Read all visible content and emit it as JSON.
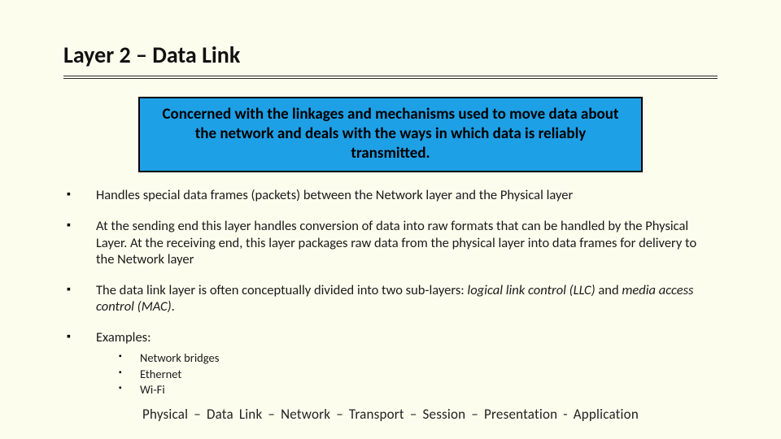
{
  "title": "Layer 2 – Data Link",
  "blurb": "Concerned with the linkages and mechanisms used to move data about the network and deals with the ways in which data is reliably transmitted.",
  "bullets": {
    "b0": "Handles special data frames (packets) between the Network layer and the Physical layer",
    "b1": "At the sending end this layer handles conversion of data into raw formats that can be handled by the Physical Layer. At the receiving end, this layer packages raw data from the physical layer into data frames for delivery to the Network layer",
    "b2_pre": "The data link layer is often conceptually divided into two sub-layers: ",
    "b2_llc": "logical link control (LLC)",
    "b2_mid": " and ",
    "b2_mac": "media access control (MAC)",
    "b2_post": ".",
    "b3": "Examples:",
    "sub": {
      "s0": "Network bridges",
      "s1": "Ethernet",
      "s2": "Wi-Fi"
    }
  },
  "footer": "Physical   –   Data Link   –   Network   –   Transport   –   Session   –   Presentation   -   Application"
}
